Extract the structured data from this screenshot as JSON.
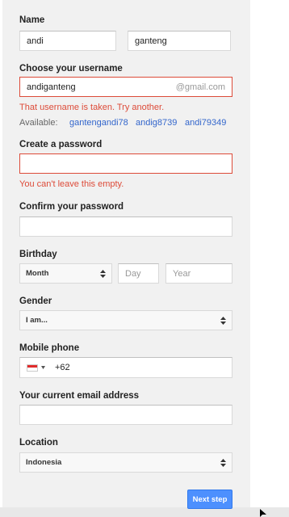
{
  "name": {
    "label": "Name",
    "first_value": "andi",
    "last_value": "ganteng"
  },
  "username": {
    "label": "Choose your username",
    "value": "andiganteng",
    "suffix": "@gmail.com",
    "error": "That username is taken. Try another.",
    "available_label": "Available:",
    "suggestions": [
      "gantengandi78",
      "andig8739",
      "andi79349"
    ]
  },
  "password": {
    "label": "Create a password",
    "value": "",
    "error": "You can't leave this empty."
  },
  "confirm_password": {
    "label": "Confirm your password",
    "value": ""
  },
  "birthday": {
    "label": "Birthday",
    "month_value": "Month",
    "day_placeholder": "Day",
    "year_placeholder": "Year"
  },
  "gender": {
    "label": "Gender",
    "value": "I am..."
  },
  "phone": {
    "label": "Mobile phone",
    "country_code": "+62",
    "flag_icon": "indonesia-flag-icon"
  },
  "current_email": {
    "label": "Your current email address",
    "value": ""
  },
  "location": {
    "label": "Location",
    "value": "Indonesia"
  },
  "actions": {
    "next_label": "Next step"
  },
  "colors": {
    "error": "#dd4b39",
    "link": "#3366cc",
    "primary_button": "#4d90fe"
  }
}
